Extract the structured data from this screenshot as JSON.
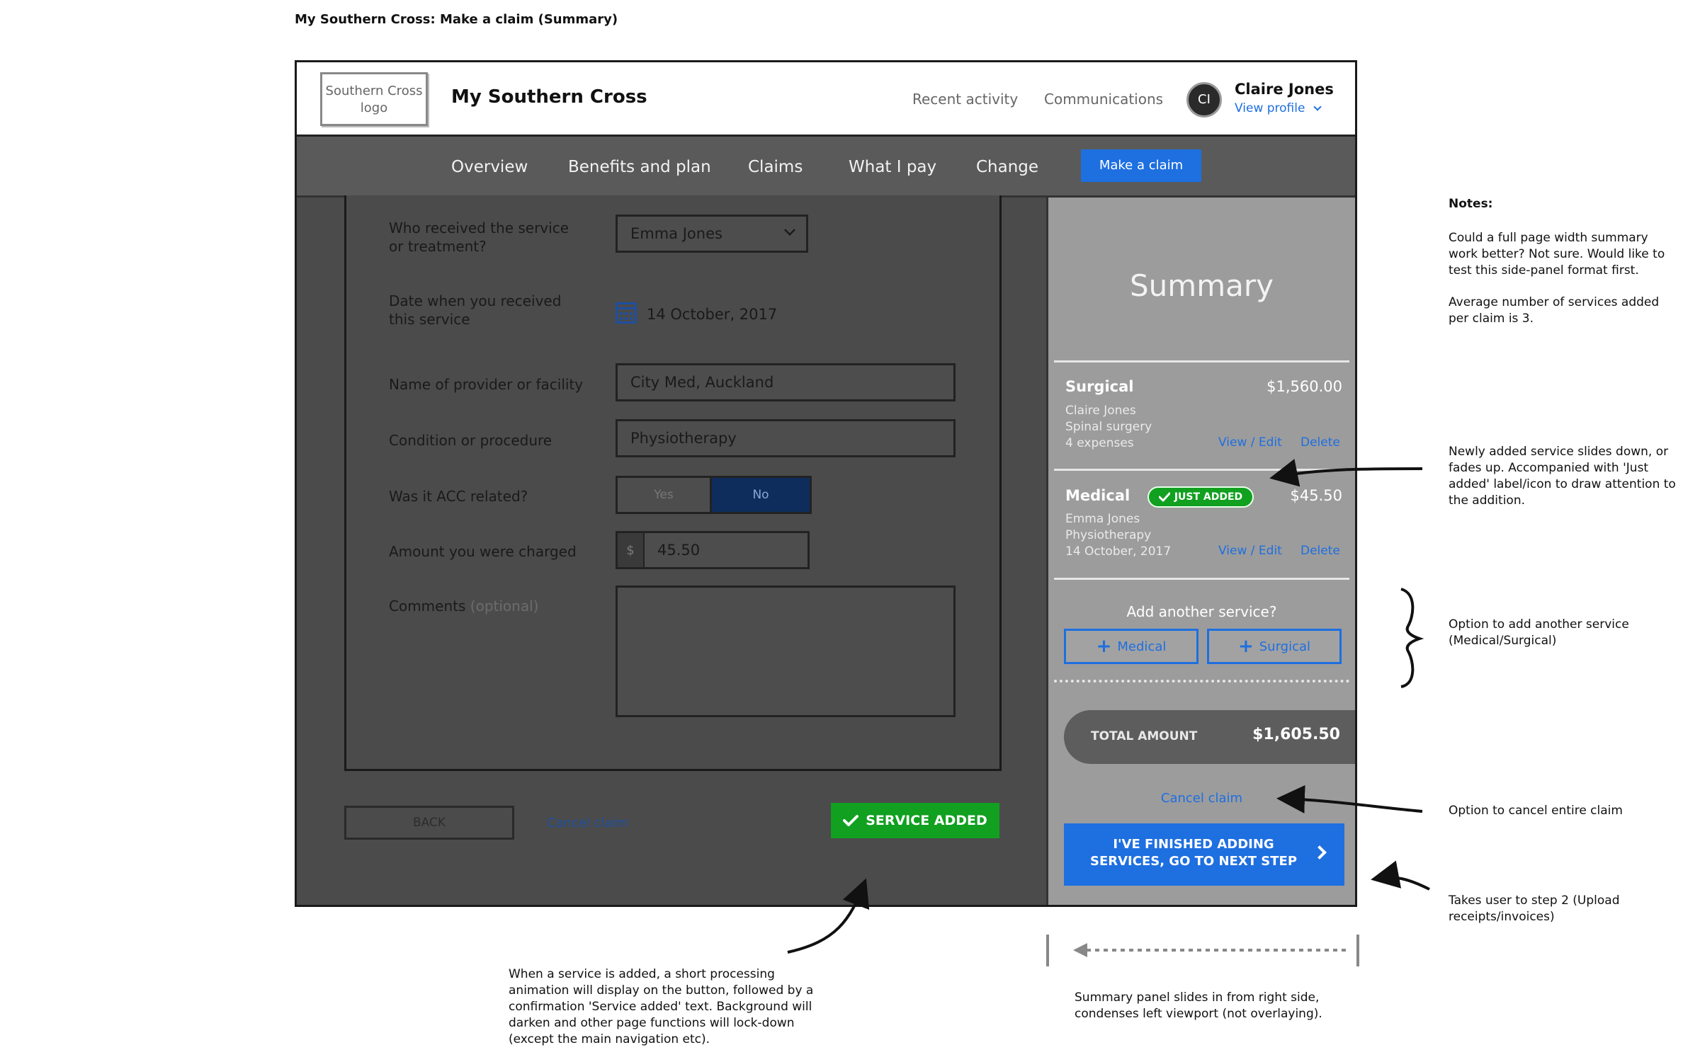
{
  "page": {
    "caption": "My Southern Cross: Make a claim (Summary)"
  },
  "header": {
    "logo_text": "Southern Cross logo",
    "brand": "My Southern Cross",
    "recent_activity": "Recent activity",
    "communications": "Communications",
    "avatar_initials": "CI",
    "user_name": "Claire Jones",
    "view_profile": "View profile"
  },
  "nav": {
    "items": [
      "Overview",
      "Benefits and plan",
      "Claims",
      "What I pay",
      "Change"
    ],
    "make_claim": "Make a claim"
  },
  "form": {
    "who_label": "Who received the service or treatment?",
    "who_value": "Emma Jones",
    "date_label": "Date when you received this service",
    "date_value": "14 October, 2017",
    "provider_label": "Name of provider or facility",
    "provider_value": "City Med, Auckland",
    "condition_label": "Condition or procedure",
    "condition_value": "Physiotherapy",
    "acc_label": "Was it ACC related?",
    "acc_yes": "Yes",
    "acc_no": "No",
    "acc_selected": "No",
    "amount_label": "Amount you were charged",
    "currency_symbol": "$",
    "amount_value": "45.50",
    "comments_label": "Comments",
    "comments_optional": "(optional)",
    "back_label": "BACK",
    "cancel_label": "Cancel claim",
    "service_added_label": "SERVICE ADDED"
  },
  "summary": {
    "title": "Summary",
    "services": [
      {
        "type": "Surgical",
        "amount": "$1,560.00",
        "details": [
          "Claire Jones",
          "Spinal surgery",
          "4 expenses"
        ],
        "view_edit": "View / Edit",
        "delete": "Delete",
        "badge": ""
      },
      {
        "type": "Medical",
        "amount": "$45.50",
        "details": [
          "Emma Jones",
          "Physiotherapy",
          "14 October, 2017"
        ],
        "view_edit": "View / Edit",
        "delete": "Delete",
        "badge": "JUST ADDED"
      }
    ],
    "add_question": "Add another service?",
    "add_medical": "Medical",
    "add_surgical": "Surgical",
    "total_label": "TOTAL AMOUNT",
    "total_value": "$1,605.50",
    "cancel_claim": "Cancel claim",
    "finish_line1": "I'VE FINISHED ADDING",
    "finish_line2": "SERVICES, GO TO NEXT STEP"
  },
  "notes": {
    "heading": "Notes:",
    "note1": [
      "Could a full page width summary",
      "work better? Not sure. Would like to",
      "test this side-panel format first."
    ],
    "note2": [
      "Average number of services added",
      "per claim is 3."
    ],
    "just_added_note": [
      "Newly added service slides down, or",
      "fades up. Accompanied with 'Just",
      "added' label/icon to draw attention to",
      "the addition."
    ],
    "add_service_note": [
      "Option to add another service",
      "(Medical/Surgical)"
    ],
    "cancel_note": [
      "Option to cancel entire claim"
    ],
    "next_step_note": [
      "Takes user to step 2 (Upload",
      "receipts/invoices)"
    ],
    "service_added_note": [
      "When a service is added, a short processing",
      "animation will display on the button, followed by a",
      "confirmation 'Service added' text. Background will",
      "darken and other page functions will lock-down",
      "(except the main navigation etc)."
    ],
    "panel_slide_note": [
      "Summary panel slides in from right side,",
      "condenses left viewport (not overlaying)."
    ]
  },
  "colors": {
    "accent_blue": "#1e6fe0",
    "success_green": "#11a020",
    "nav_gray": "#5a5a5a",
    "overlay_dark": "#4b4b4b",
    "panel_gray": "#9c9c9c"
  }
}
